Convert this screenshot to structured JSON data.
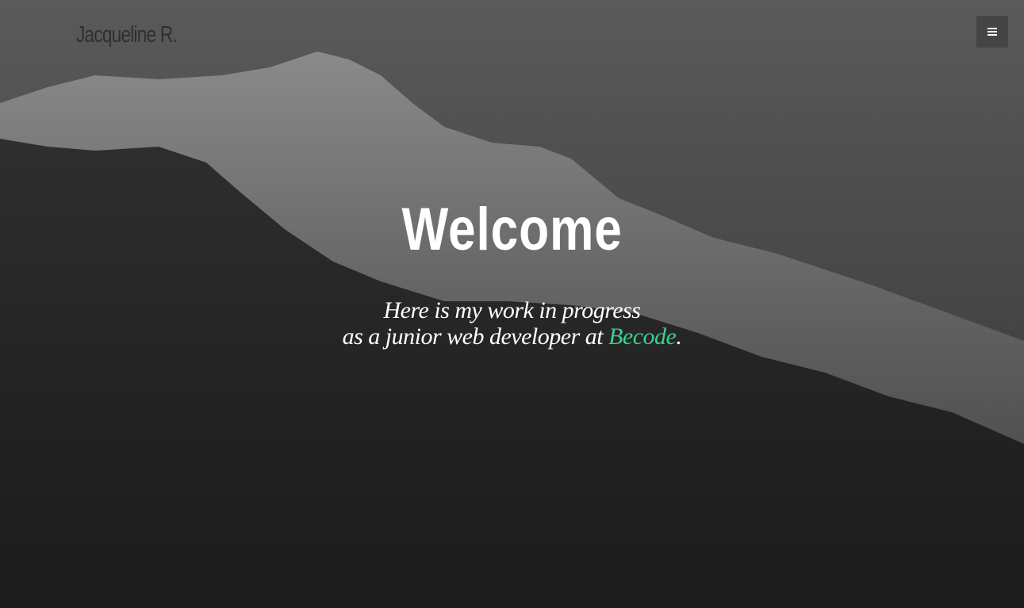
{
  "header": {
    "brand": "Jacqueline R.",
    "menu_icon": "hamburger-menu-icon"
  },
  "hero": {
    "title": "Welcome",
    "line1": "Here is my work in progress",
    "line2_prefix": "as a junior web developer at ",
    "link_text": "Becode",
    "line2_suffix": "."
  },
  "colors": {
    "accent": "#3ccf91",
    "background": "#1c1c1c",
    "menu_button": "#454545"
  }
}
